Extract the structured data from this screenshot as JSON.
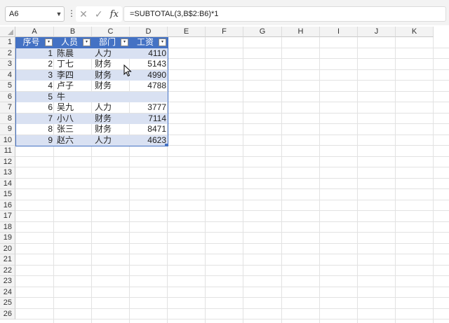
{
  "formula_bar": {
    "name_box": "A6",
    "more_glyph": "⋮",
    "cancel_glyph": "✕",
    "enter_glyph": "✓",
    "fx_label": "fx",
    "formula": "=SUBTOTAL(3,B$2:B6)*1"
  },
  "columns": [
    "A",
    "B",
    "C",
    "D",
    "E",
    "F",
    "G",
    "H",
    "I",
    "J",
    "K"
  ],
  "rows": [
    "1",
    "2",
    "3",
    "4",
    "5",
    "6",
    "7",
    "8",
    "9",
    "10",
    "11",
    "12",
    "13",
    "14",
    "15",
    "16",
    "17",
    "18",
    "19",
    "20",
    "21",
    "22",
    "23",
    "24",
    "25",
    "26"
  ],
  "table": {
    "headers": [
      "序号",
      "人员",
      "部门",
      "工资"
    ],
    "filter_glyph": "▾",
    "data": [
      {
        "no": "1",
        "name": "陈晨",
        "dept": "人力",
        "salary": "4110"
      },
      {
        "no": "2",
        "name": "丁七",
        "dept": "财务",
        "salary": "5143"
      },
      {
        "no": "3",
        "name": "李四",
        "dept": "财务",
        "salary": "4990"
      },
      {
        "no": "4",
        "name": "卢子",
        "dept": "财务",
        "salary": "4788"
      },
      {
        "no": "5",
        "name": "牛",
        "dept": "",
        "salary": ""
      },
      {
        "no": "6",
        "name": "吴九",
        "dept": "人力",
        "salary": "3777"
      },
      {
        "no": "7",
        "name": "小八",
        "dept": "财务",
        "salary": "7114"
      },
      {
        "no": "8",
        "name": "张三",
        "dept": "财务",
        "salary": "8471"
      },
      {
        "no": "9",
        "name": "赵六",
        "dept": "人力",
        "salary": "4623"
      }
    ]
  },
  "colors": {
    "table_header": "#4472c4",
    "table_band": "#d9e1f2"
  }
}
